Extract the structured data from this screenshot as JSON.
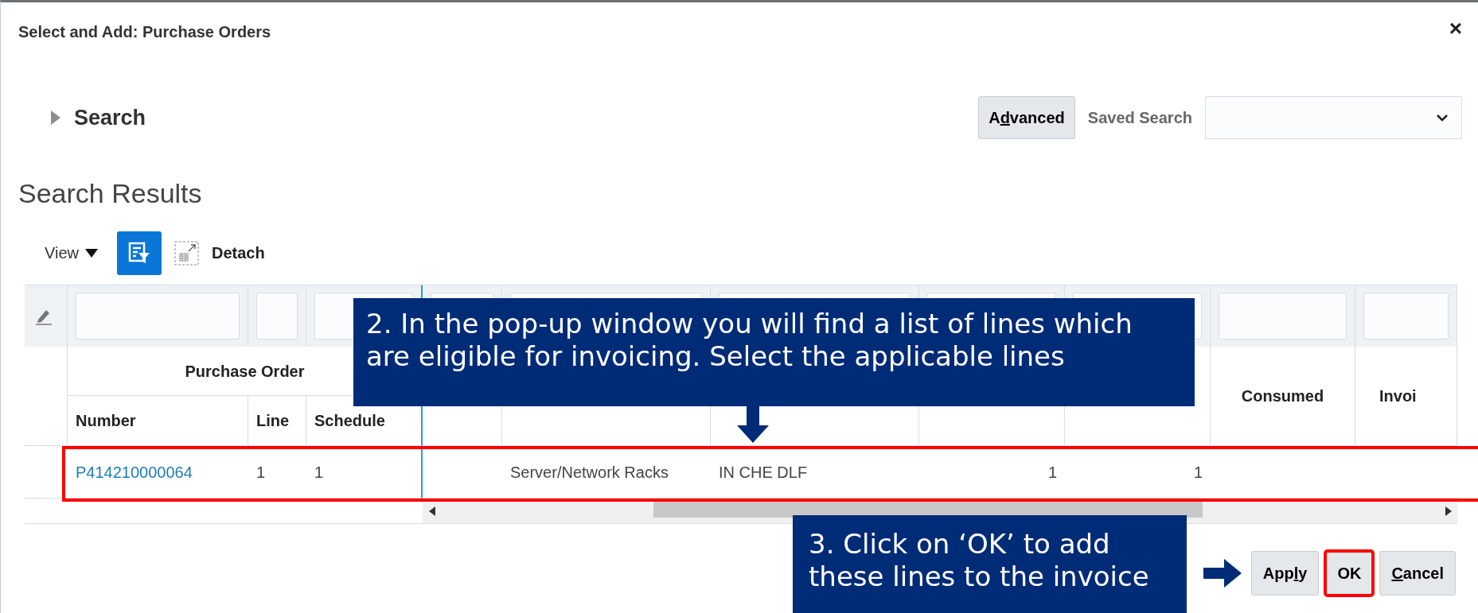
{
  "dialog": {
    "title": "Select and Add: Purchase Orders",
    "close": "×"
  },
  "search": {
    "label": "Search",
    "expanded": false,
    "advanced": [
      {
        "text": "A",
        "underlined": false
      },
      {
        "text": "d",
        "underlined": true
      },
      {
        "text": "vanced",
        "underlined": false
      }
    ],
    "saved_search": {
      "label": "Saved Search"
    }
  },
  "results": {
    "title": "Search Results",
    "view": "View",
    "detach": "Detach"
  },
  "table": {
    "group_header": "Purchase Order",
    "columns": [
      {
        "label": "Number",
        "group": true
      },
      {
        "label": "Line",
        "group": true
      },
      {
        "label": "Schedule",
        "group": true
      },
      {
        "group": false
      },
      {
        "group": false
      },
      {
        "group": false
      },
      {
        "group": false
      },
      {
        "group": false
      },
      {
        "label": "Consumed",
        "group": false
      },
      {
        "label": "Invoi",
        "group": false
      }
    ],
    "rows": [
      {
        "cells": [
          {
            "text": "P414210000064",
            "kind": "link"
          },
          {
            "text": "1",
            "kind": "text"
          },
          {
            "text": "1",
            "kind": "text"
          },
          {
            "kind": "empty"
          },
          {
            "text": "Server/Network Racks",
            "kind": "text"
          },
          {
            "text": "IN CHE DLF",
            "kind": "text"
          },
          {
            "text": "1",
            "kind": "number"
          },
          {
            "text": "1",
            "kind": "number"
          },
          {
            "kind": "empty"
          },
          {
            "kind": "empty"
          }
        ],
        "highlighted": true
      }
    ]
  },
  "buttons": [
    {
      "parts": [
        {
          "text": "App",
          "underlined": false
        },
        {
          "text": "l",
          "underlined": true
        },
        {
          "text": "y",
          "underlined": false
        }
      ],
      "highlighted": false
    },
    {
      "parts": [
        {
          "text": "OK",
          "underlined": false
        }
      ],
      "highlighted": true
    },
    {
      "parts": [
        {
          "text": "C",
          "underlined": true
        },
        {
          "text": "ancel",
          "underlined": false
        }
      ],
      "highlighted": false
    }
  ],
  "callouts": [
    {
      "text": "2. In the pop-up window you will find a list of lines which are eligible for invoicing. Select the applicable lines",
      "kind": "down"
    },
    {
      "text": "3. Click on ‘OK’ to add these lines to the invoice",
      "kind": "right"
    }
  ]
}
